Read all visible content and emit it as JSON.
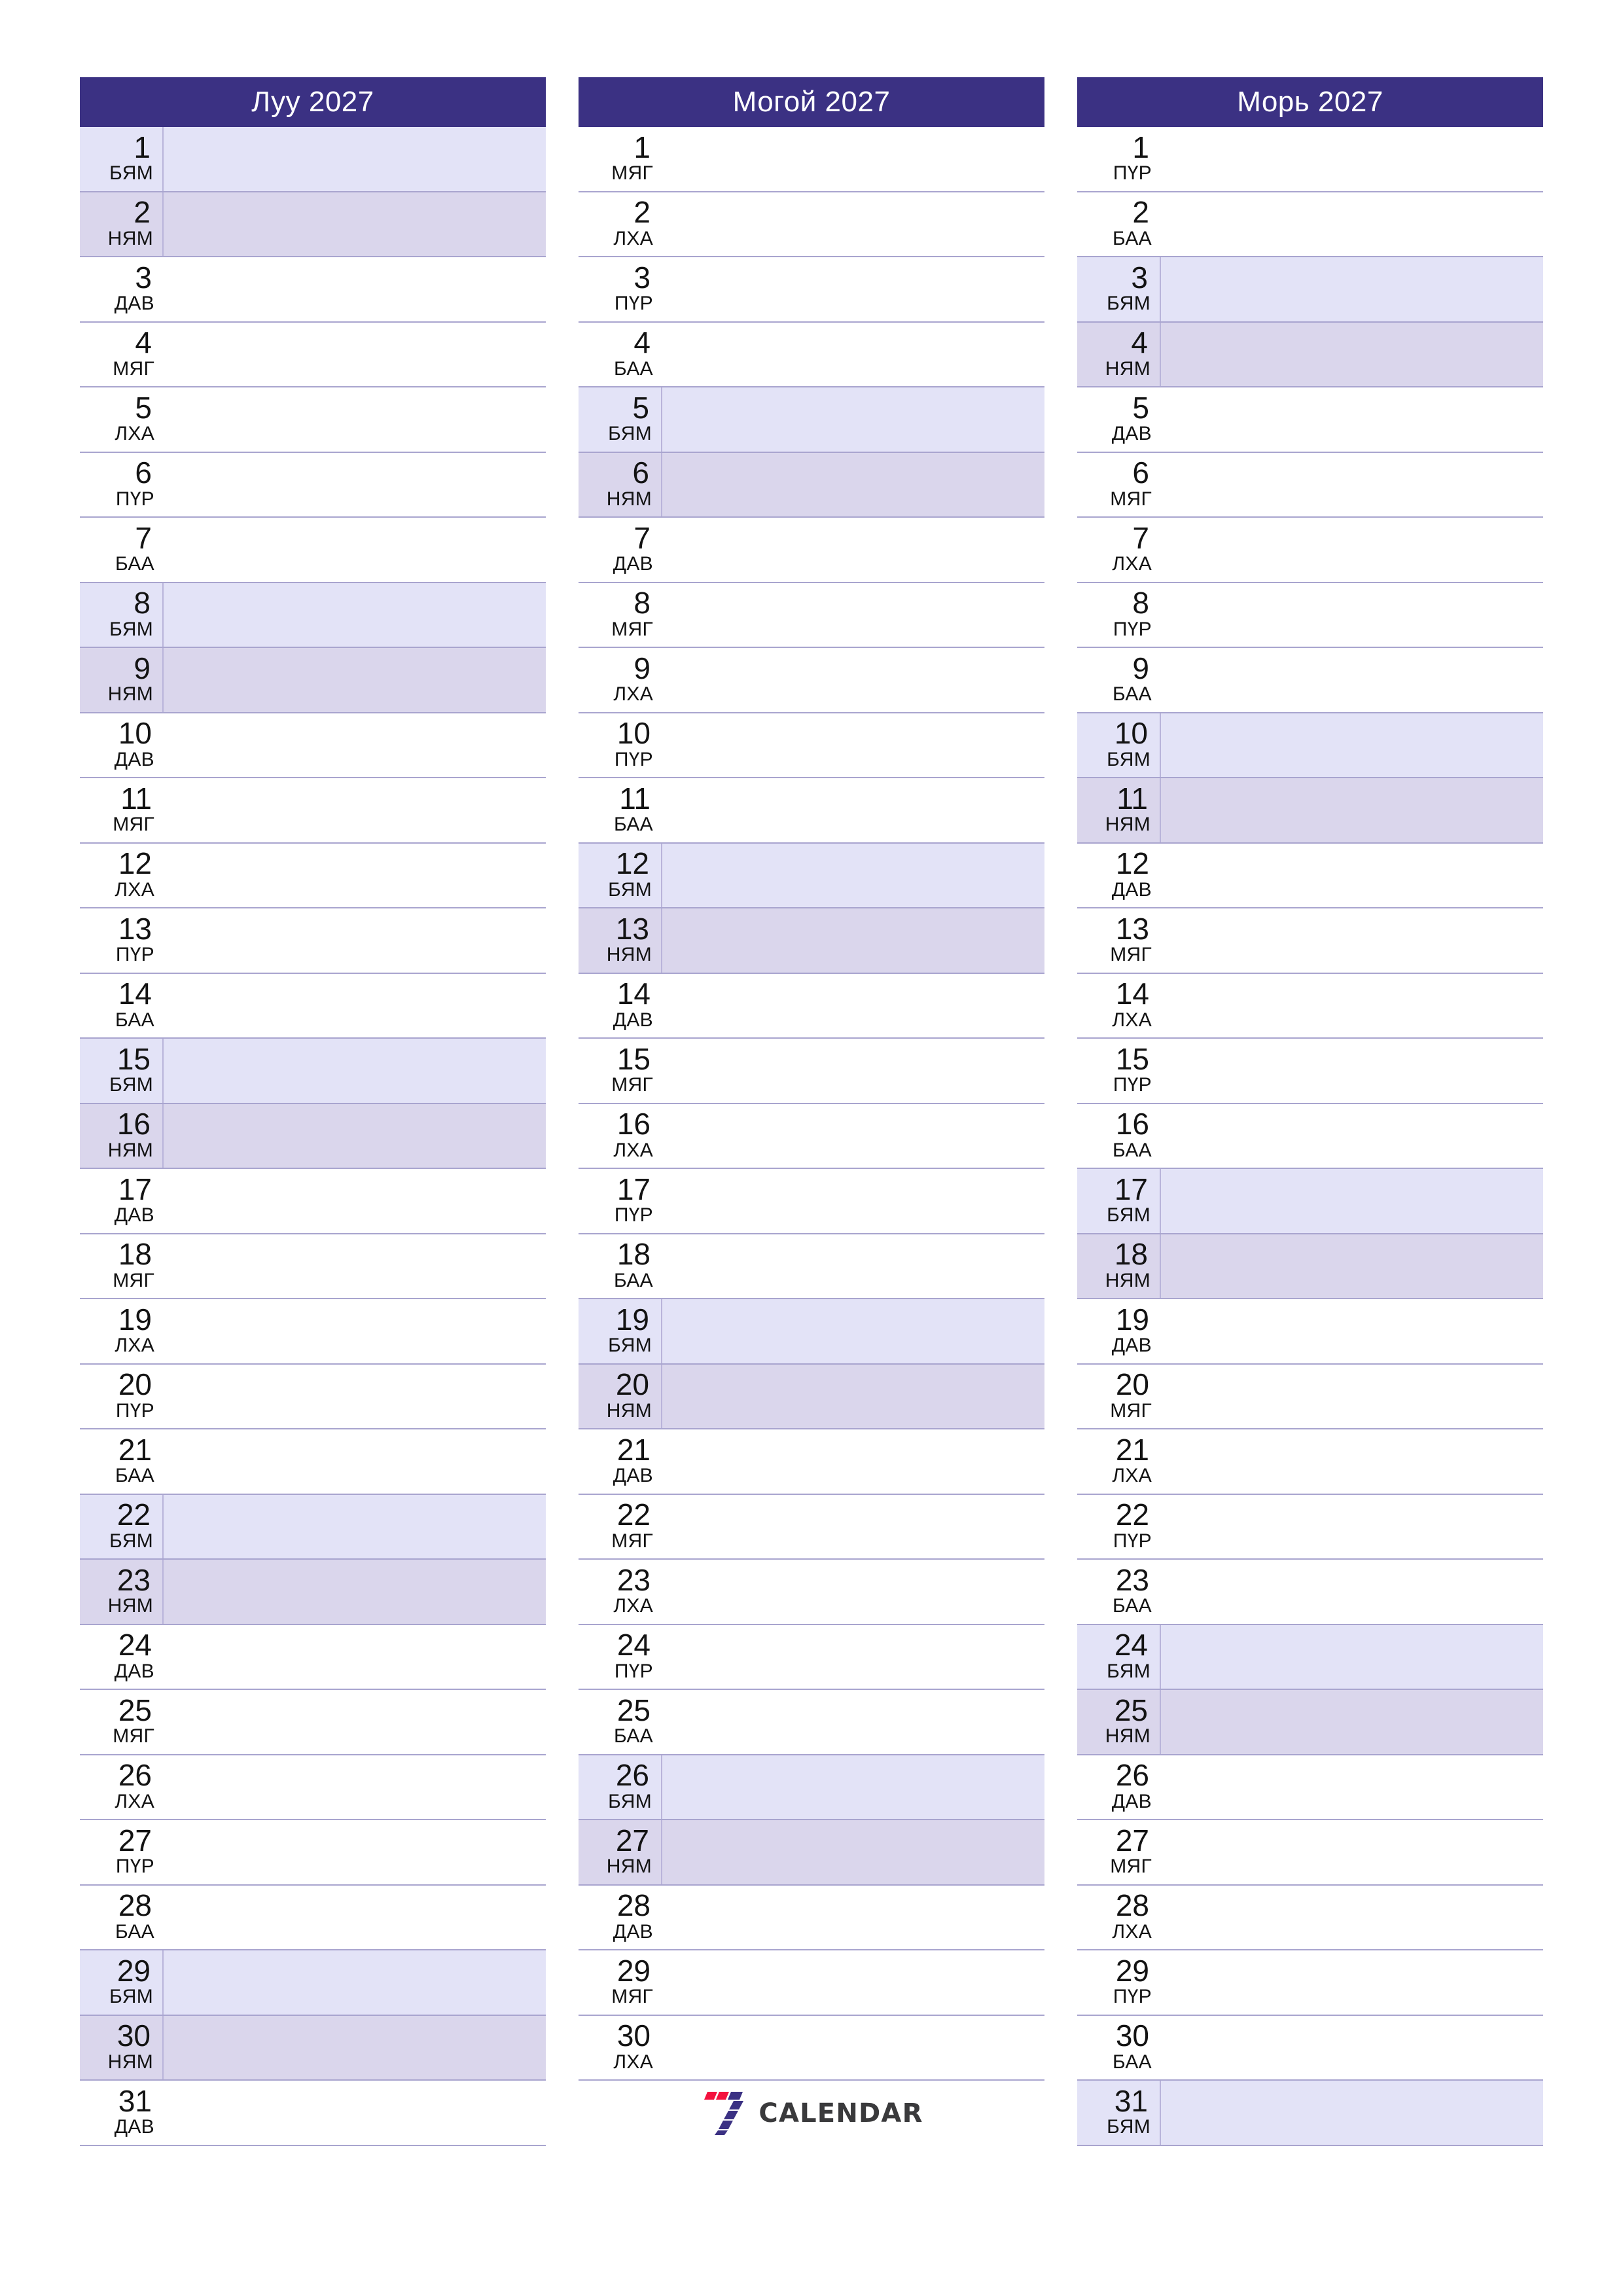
{
  "weekday_names": {
    "mon": "ДАВ",
    "tue": "МЯГ",
    "wed": "ЛХА",
    "thu": "ПҮР",
    "fri": "БАА",
    "sat": "БЯМ",
    "sun": "НЯМ"
  },
  "colors": {
    "header_bg": "#3b3183",
    "header_text": "#ffffff",
    "saturday_bg": "#e3e3f7",
    "sunday_bg": "#dad6ec",
    "row_rule": "#a9a5cf",
    "day_text": "#131313",
    "logo_red": "#f4123e",
    "logo_blue": "#3b3183",
    "logo_text": "#3a3a3c"
  },
  "brand": {
    "name": "CALENDAR",
    "mark_name": "seven-logo-mark"
  },
  "months": [
    {
      "title": "Луу 2027",
      "days": [
        {
          "n": "1",
          "wd": "БЯМ",
          "type": "sat"
        },
        {
          "n": "2",
          "wd": "НЯМ",
          "type": "sun"
        },
        {
          "n": "3",
          "wd": "ДАВ",
          "type": "wd"
        },
        {
          "n": "4",
          "wd": "МЯГ",
          "type": "wd"
        },
        {
          "n": "5",
          "wd": "ЛХА",
          "type": "wd"
        },
        {
          "n": "6",
          "wd": "ПҮР",
          "type": "wd"
        },
        {
          "n": "7",
          "wd": "БАА",
          "type": "wd"
        },
        {
          "n": "8",
          "wd": "БЯМ",
          "type": "sat"
        },
        {
          "n": "9",
          "wd": "НЯМ",
          "type": "sun"
        },
        {
          "n": "10",
          "wd": "ДАВ",
          "type": "wd"
        },
        {
          "n": "11",
          "wd": "МЯГ",
          "type": "wd"
        },
        {
          "n": "12",
          "wd": "ЛХА",
          "type": "wd"
        },
        {
          "n": "13",
          "wd": "ПҮР",
          "type": "wd"
        },
        {
          "n": "14",
          "wd": "БАА",
          "type": "wd"
        },
        {
          "n": "15",
          "wd": "БЯМ",
          "type": "sat"
        },
        {
          "n": "16",
          "wd": "НЯМ",
          "type": "sun"
        },
        {
          "n": "17",
          "wd": "ДАВ",
          "type": "wd"
        },
        {
          "n": "18",
          "wd": "МЯГ",
          "type": "wd"
        },
        {
          "n": "19",
          "wd": "ЛХА",
          "type": "wd"
        },
        {
          "n": "20",
          "wd": "ПҮР",
          "type": "wd"
        },
        {
          "n": "21",
          "wd": "БАА",
          "type": "wd"
        },
        {
          "n": "22",
          "wd": "БЯМ",
          "type": "sat"
        },
        {
          "n": "23",
          "wd": "НЯМ",
          "type": "sun"
        },
        {
          "n": "24",
          "wd": "ДАВ",
          "type": "wd"
        },
        {
          "n": "25",
          "wd": "МЯГ",
          "type": "wd"
        },
        {
          "n": "26",
          "wd": "ЛХА",
          "type": "wd"
        },
        {
          "n": "27",
          "wd": "ПҮР",
          "type": "wd"
        },
        {
          "n": "28",
          "wd": "БАА",
          "type": "wd"
        },
        {
          "n": "29",
          "wd": "БЯМ",
          "type": "sat"
        },
        {
          "n": "30",
          "wd": "НЯМ",
          "type": "sun"
        },
        {
          "n": "31",
          "wd": "ДАВ",
          "type": "wd"
        }
      ],
      "has_logo": false
    },
    {
      "title": "Могой 2027",
      "days": [
        {
          "n": "1",
          "wd": "МЯГ",
          "type": "wd"
        },
        {
          "n": "2",
          "wd": "ЛХА",
          "type": "wd"
        },
        {
          "n": "3",
          "wd": "ПҮР",
          "type": "wd"
        },
        {
          "n": "4",
          "wd": "БАА",
          "type": "wd"
        },
        {
          "n": "5",
          "wd": "БЯМ",
          "type": "sat"
        },
        {
          "n": "6",
          "wd": "НЯМ",
          "type": "sun"
        },
        {
          "n": "7",
          "wd": "ДАВ",
          "type": "wd"
        },
        {
          "n": "8",
          "wd": "МЯГ",
          "type": "wd"
        },
        {
          "n": "9",
          "wd": "ЛХА",
          "type": "wd"
        },
        {
          "n": "10",
          "wd": "ПҮР",
          "type": "wd"
        },
        {
          "n": "11",
          "wd": "БАА",
          "type": "wd"
        },
        {
          "n": "12",
          "wd": "БЯМ",
          "type": "sat"
        },
        {
          "n": "13",
          "wd": "НЯМ",
          "type": "sun"
        },
        {
          "n": "14",
          "wd": "ДАВ",
          "type": "wd"
        },
        {
          "n": "15",
          "wd": "МЯГ",
          "type": "wd"
        },
        {
          "n": "16",
          "wd": "ЛХА",
          "type": "wd"
        },
        {
          "n": "17",
          "wd": "ПҮР",
          "type": "wd"
        },
        {
          "n": "18",
          "wd": "БАА",
          "type": "wd"
        },
        {
          "n": "19",
          "wd": "БЯМ",
          "type": "sat"
        },
        {
          "n": "20",
          "wd": "НЯМ",
          "type": "sun"
        },
        {
          "n": "21",
          "wd": "ДАВ",
          "type": "wd"
        },
        {
          "n": "22",
          "wd": "МЯГ",
          "type": "wd"
        },
        {
          "n": "23",
          "wd": "ЛХА",
          "type": "wd"
        },
        {
          "n": "24",
          "wd": "ПҮР",
          "type": "wd"
        },
        {
          "n": "25",
          "wd": "БАА",
          "type": "wd"
        },
        {
          "n": "26",
          "wd": "БЯМ",
          "type": "sat"
        },
        {
          "n": "27",
          "wd": "НЯМ",
          "type": "sun"
        },
        {
          "n": "28",
          "wd": "ДАВ",
          "type": "wd"
        },
        {
          "n": "29",
          "wd": "МЯГ",
          "type": "wd"
        },
        {
          "n": "30",
          "wd": "ЛХА",
          "type": "wd"
        }
      ],
      "has_logo": true
    },
    {
      "title": "Морь 2027",
      "days": [
        {
          "n": "1",
          "wd": "ПҮР",
          "type": "wd"
        },
        {
          "n": "2",
          "wd": "БАА",
          "type": "wd"
        },
        {
          "n": "3",
          "wd": "БЯМ",
          "type": "sat"
        },
        {
          "n": "4",
          "wd": "НЯМ",
          "type": "sun"
        },
        {
          "n": "5",
          "wd": "ДАВ",
          "type": "wd"
        },
        {
          "n": "6",
          "wd": "МЯГ",
          "type": "wd"
        },
        {
          "n": "7",
          "wd": "ЛХА",
          "type": "wd"
        },
        {
          "n": "8",
          "wd": "ПҮР",
          "type": "wd"
        },
        {
          "n": "9",
          "wd": "БАА",
          "type": "wd"
        },
        {
          "n": "10",
          "wd": "БЯМ",
          "type": "sat"
        },
        {
          "n": "11",
          "wd": "НЯМ",
          "type": "sun"
        },
        {
          "n": "12",
          "wd": "ДАВ",
          "type": "wd"
        },
        {
          "n": "13",
          "wd": "МЯГ",
          "type": "wd"
        },
        {
          "n": "14",
          "wd": "ЛХА",
          "type": "wd"
        },
        {
          "n": "15",
          "wd": "ПҮР",
          "type": "wd"
        },
        {
          "n": "16",
          "wd": "БАА",
          "type": "wd"
        },
        {
          "n": "17",
          "wd": "БЯМ",
          "type": "sat"
        },
        {
          "n": "18",
          "wd": "НЯМ",
          "type": "sun"
        },
        {
          "n": "19",
          "wd": "ДАВ",
          "type": "wd"
        },
        {
          "n": "20",
          "wd": "МЯГ",
          "type": "wd"
        },
        {
          "n": "21",
          "wd": "ЛХА",
          "type": "wd"
        },
        {
          "n": "22",
          "wd": "ПҮР",
          "type": "wd"
        },
        {
          "n": "23",
          "wd": "БАА",
          "type": "wd"
        },
        {
          "n": "24",
          "wd": "БЯМ",
          "type": "sat"
        },
        {
          "n": "25",
          "wd": "НЯМ",
          "type": "sun"
        },
        {
          "n": "26",
          "wd": "ДАВ",
          "type": "wd"
        },
        {
          "n": "27",
          "wd": "МЯГ",
          "type": "wd"
        },
        {
          "n": "28",
          "wd": "ЛХА",
          "type": "wd"
        },
        {
          "n": "29",
          "wd": "ПҮР",
          "type": "wd"
        },
        {
          "n": "30",
          "wd": "БАА",
          "type": "wd"
        },
        {
          "n": "31",
          "wd": "БЯМ",
          "type": "sat"
        }
      ],
      "has_logo": false
    }
  ]
}
